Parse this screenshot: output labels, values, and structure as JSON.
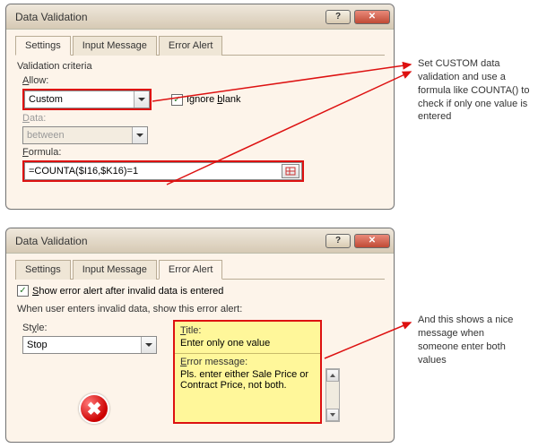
{
  "dialog1": {
    "title": "Data Validation",
    "tabs": [
      "Settings",
      "Input Message",
      "Error Alert"
    ],
    "active_tab": 0,
    "criteria_label": "Validation criteria",
    "allow_label": "Allow:",
    "allow_value": "Custom",
    "ignore_blank_label": "Ignore blank",
    "ignore_blank_checked": true,
    "data_label": "Data:",
    "data_value": "between",
    "formula_label": "Formula:",
    "formula_value": "=COUNTA($I16,$K16)=1"
  },
  "dialog2": {
    "title": "Data Validation",
    "tabs": [
      "Settings",
      "Input Message",
      "Error Alert"
    ],
    "active_tab": 2,
    "show_alert_label": "Show error alert after invalid data is entered",
    "show_alert_checked": true,
    "instruction": "When user enters invalid data, show this error alert:",
    "style_label": "Style:",
    "style_value": "Stop",
    "title_label": "Title:",
    "title_value": "Enter only one value",
    "msg_label": "Error message:",
    "msg_value": "Pls. enter either Sale Price or Contract Price, not both."
  },
  "annotation1": "Set CUSTOM data validation and use a formula like COUNTA() to check if only one value is entered",
  "annotation2": "And this shows a nice message when someone enter both values",
  "colors": {
    "highlight_red": "#d11",
    "highlight_yellow": "#fff79a"
  }
}
